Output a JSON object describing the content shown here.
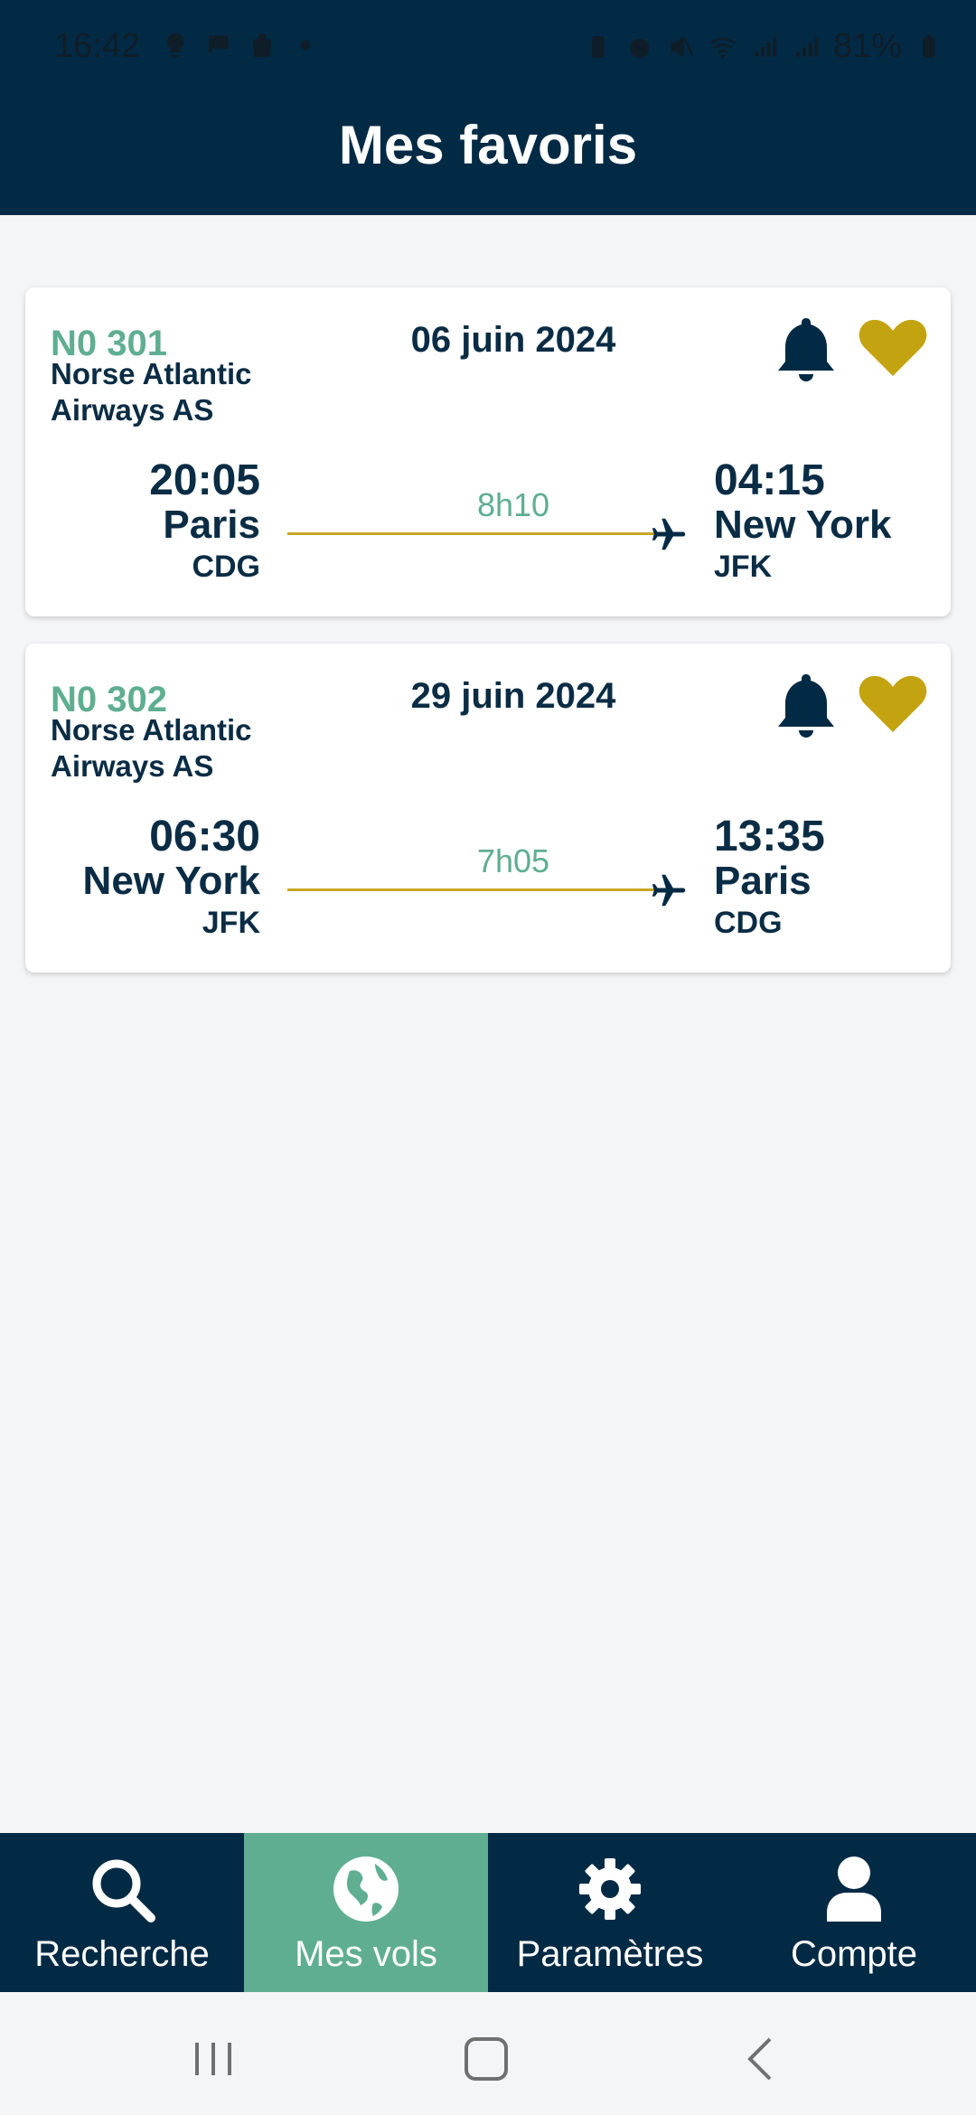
{
  "status_bar": {
    "time": "16:42",
    "battery": "81%",
    "left_icons": [
      "bulb-icon",
      "chat-icon",
      "bag-icon",
      "dot-icon"
    ],
    "right_icons": [
      "battery-saver-icon",
      "alarm-icon",
      "mute-icon",
      "wifi-icon",
      "signal-icon",
      "signal-icon",
      "battery-icon"
    ]
  },
  "header": {
    "title": "Mes favoris"
  },
  "colors": {
    "primary": "#032a45",
    "accent_green": "#5fae92",
    "gold": "#c8a722",
    "background": "#f4f5f6"
  },
  "flights": [
    {
      "number": "N0 301",
      "airline": "Norse Atlantic Airways AS",
      "date": "06 juin 2024",
      "departure": {
        "time": "20:05",
        "city": "Paris",
        "code": "CDG"
      },
      "arrival": {
        "time": "04:15",
        "city": "New York",
        "code": "JFK"
      },
      "duration": "8h10",
      "favorite": true
    },
    {
      "number": "N0 302",
      "airline": "Norse Atlantic Airways AS",
      "date": "29 juin 2024",
      "departure": {
        "time": "06:30",
        "city": "New York",
        "code": "JFK"
      },
      "arrival": {
        "time": "13:35",
        "city": "Paris",
        "code": "CDG"
      },
      "duration": "7h05",
      "favorite": true
    }
  ],
  "bottom_nav": {
    "items": [
      {
        "label": "Recherche",
        "icon": "search-icon",
        "active": false
      },
      {
        "label": "Mes vols",
        "icon": "globe-icon",
        "active": true
      },
      {
        "label": "Paramètres",
        "icon": "gear-icon",
        "active": false
      },
      {
        "label": "Compte",
        "icon": "user-icon",
        "active": false
      }
    ]
  },
  "system_nav": [
    "recents-button",
    "home-button",
    "back-button"
  ]
}
